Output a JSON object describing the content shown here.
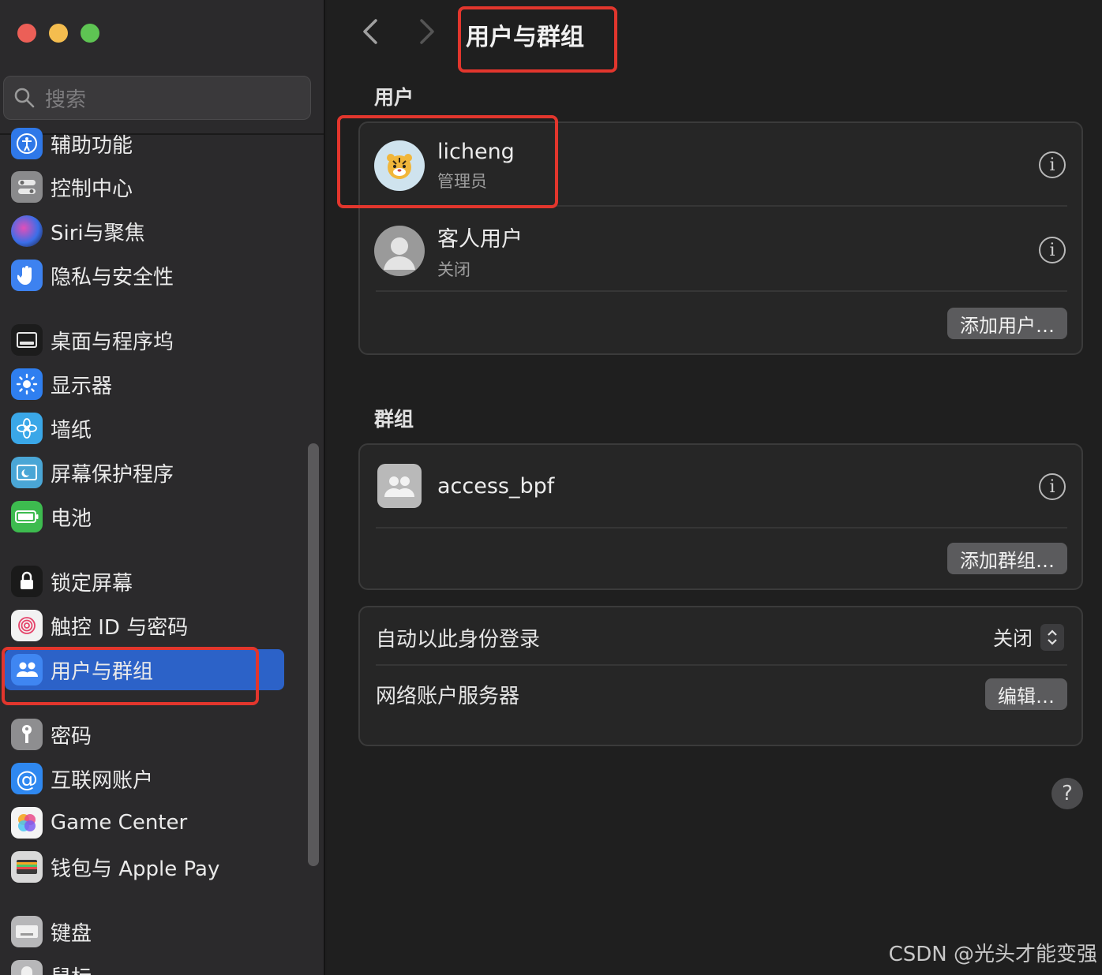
{
  "search": {
    "placeholder": "搜索"
  },
  "sidebar": {
    "items": [
      {
        "label": "辅助功能",
        "icon": "accessibility-icon",
        "color": "#2f78e8"
      },
      {
        "label": "控制中心",
        "icon": "control-center-icon",
        "color": "#8a8a8c"
      },
      {
        "label": "Siri与聚焦",
        "icon": "siri-icon",
        "color": "#6b3fc2"
      },
      {
        "label": "隐私与安全性",
        "icon": "hand-icon",
        "color": "#3d82f0"
      },
      {
        "label": "桌面与程序坞",
        "icon": "dock-icon",
        "color": "#1c1c1c"
      },
      {
        "label": "显示器",
        "icon": "sun-icon",
        "color": "#2f7ff0"
      },
      {
        "label": "墙纸",
        "icon": "flower-icon",
        "color": "#3aa7e8"
      },
      {
        "label": "屏幕保护程序",
        "icon": "screensaver-icon",
        "color": "#4aa6d6"
      },
      {
        "label": "电池",
        "icon": "battery-icon",
        "color": "#3dbb4f"
      },
      {
        "label": "锁定屏幕",
        "icon": "lock-icon",
        "color": "#1a1a1a"
      },
      {
        "label": "触控 ID 与密码",
        "icon": "fingerprint-icon",
        "color": "#f2f2f2"
      },
      {
        "label": "用户与群组",
        "icon": "users-icon",
        "color": "#3f86f2"
      },
      {
        "label": "密码",
        "icon": "key-icon",
        "color": "#8e8e90"
      },
      {
        "label": "互联网账户",
        "icon": "at-icon",
        "color": "#2f88f0"
      },
      {
        "label": "Game Center",
        "icon": "game-center-icon",
        "color": "#f4f4f4"
      },
      {
        "label": "钱包与 Apple Pay",
        "icon": "wallet-icon",
        "color": "#d9d9d9"
      },
      {
        "label": "键盘",
        "icon": "keyboard-icon",
        "color": "#b7b7b9"
      },
      {
        "label": "鼠标",
        "icon": "mouse-icon",
        "color": "#b7b7b9"
      }
    ]
  },
  "header": {
    "title": "用户与群组"
  },
  "users": {
    "section_title": "用户",
    "list": [
      {
        "name": "licheng",
        "role": "管理员"
      },
      {
        "name": "客人用户",
        "role": "关闭"
      }
    ],
    "add_button": "添加用户…"
  },
  "groups": {
    "section_title": "群组",
    "list": [
      {
        "name": "access_bpf"
      }
    ],
    "add_button": "添加群组…"
  },
  "settings": {
    "auto_login_label": "自动以此身份登录",
    "auto_login_value": "关闭",
    "network_server_label": "网络账户服务器",
    "edit_button": "编辑…"
  },
  "help": "?",
  "watermark": "CSDN @光头才能变强",
  "colors": {
    "accent": "#2c62c8",
    "highlight_box": "#e2362d"
  }
}
